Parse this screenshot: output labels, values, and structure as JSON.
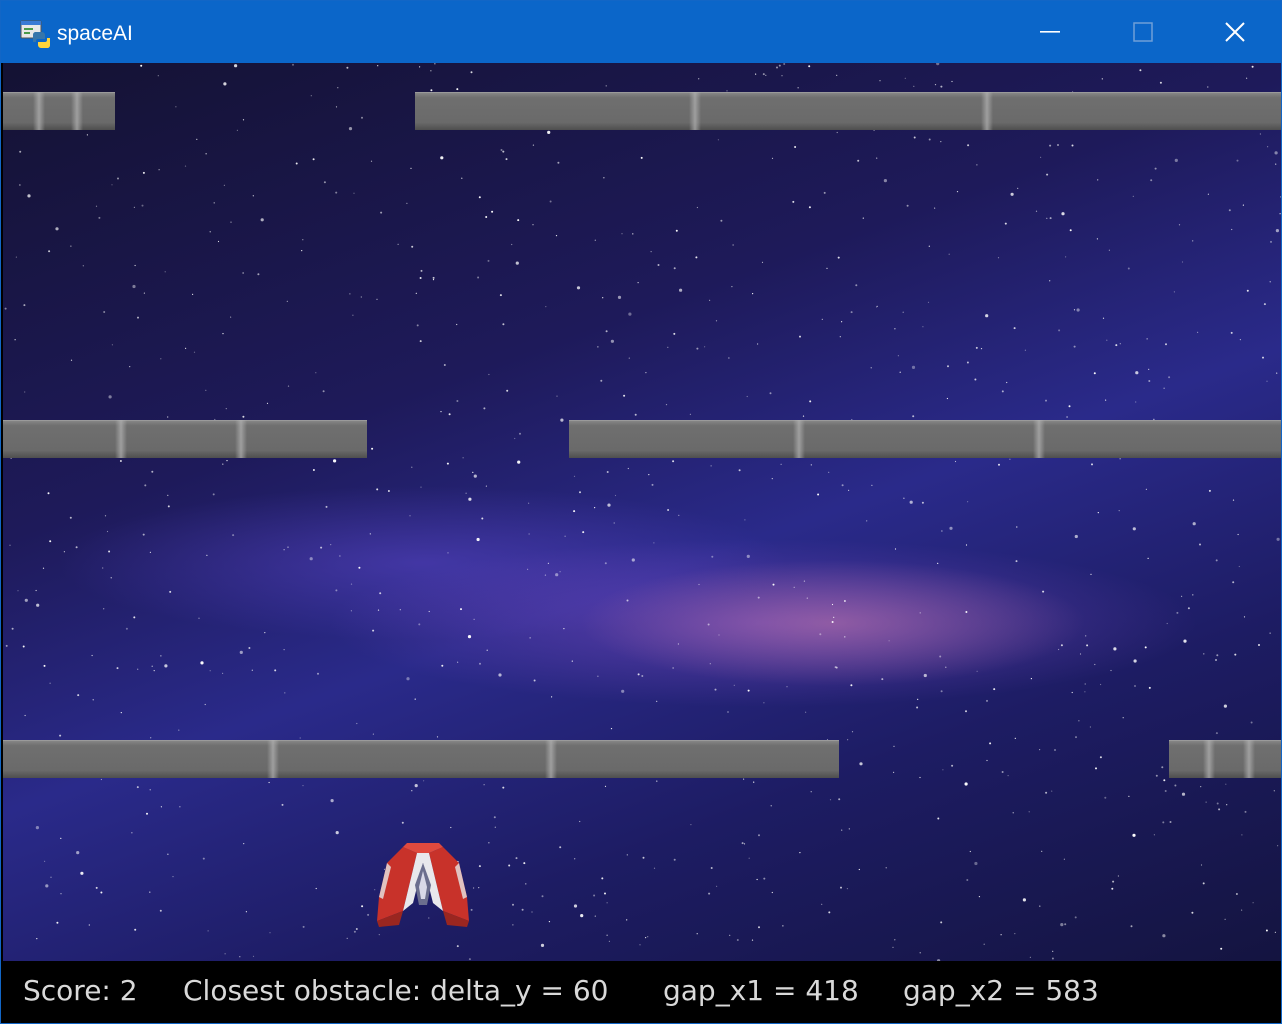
{
  "window": {
    "title": "spaceAI",
    "icon": "python-icon",
    "titlebar_color": "#0b66c9"
  },
  "game": {
    "player": "red-spaceship",
    "obstacle_color": "#6a6a6a",
    "background": "starry-milky-way"
  },
  "hud": {
    "score": "Score: 2",
    "closest": "Closest obstacle: delta_y = 60",
    "gap_x1": "gap_x1 = 418",
    "gap_x2": "gap_x2 = 583"
  }
}
